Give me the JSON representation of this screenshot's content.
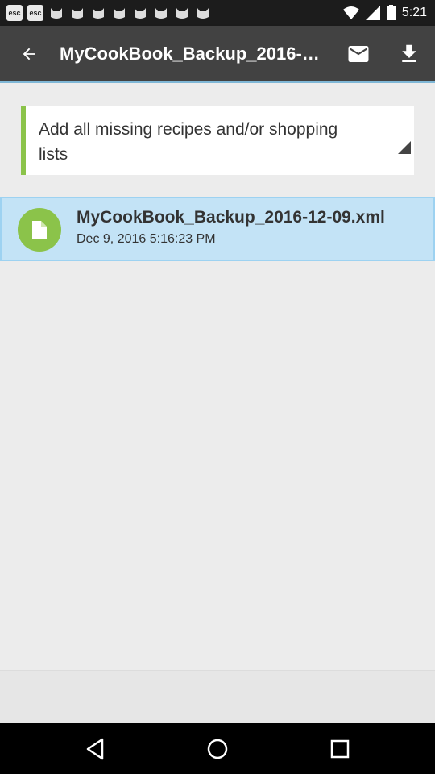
{
  "status_bar": {
    "notifications": [
      "esc",
      "esc"
    ],
    "time": "5:21"
  },
  "toolbar": {
    "title": "MyCookBook_Backup_2016-12-09.xml",
    "back_icon": "arrow-back-icon",
    "mail_icon": "mail-icon",
    "download_icon": "download-icon"
  },
  "import_option": {
    "selected": "Add all missing recipes and/or shopping lists"
  },
  "files": [
    {
      "name": "MyCookBook_Backup_2016-12-09.xml",
      "date": "Dec 9, 2016 5:16:23 PM",
      "icon": "document-icon"
    }
  ],
  "nav": {
    "back_icon": "nav-back-icon",
    "home_icon": "nav-home-icon",
    "recents_icon": "nav-recents-icon"
  },
  "colors": {
    "toolbar": "#424242",
    "accent_green": "#8bc34a",
    "selected_row": "#c3e3f6"
  }
}
